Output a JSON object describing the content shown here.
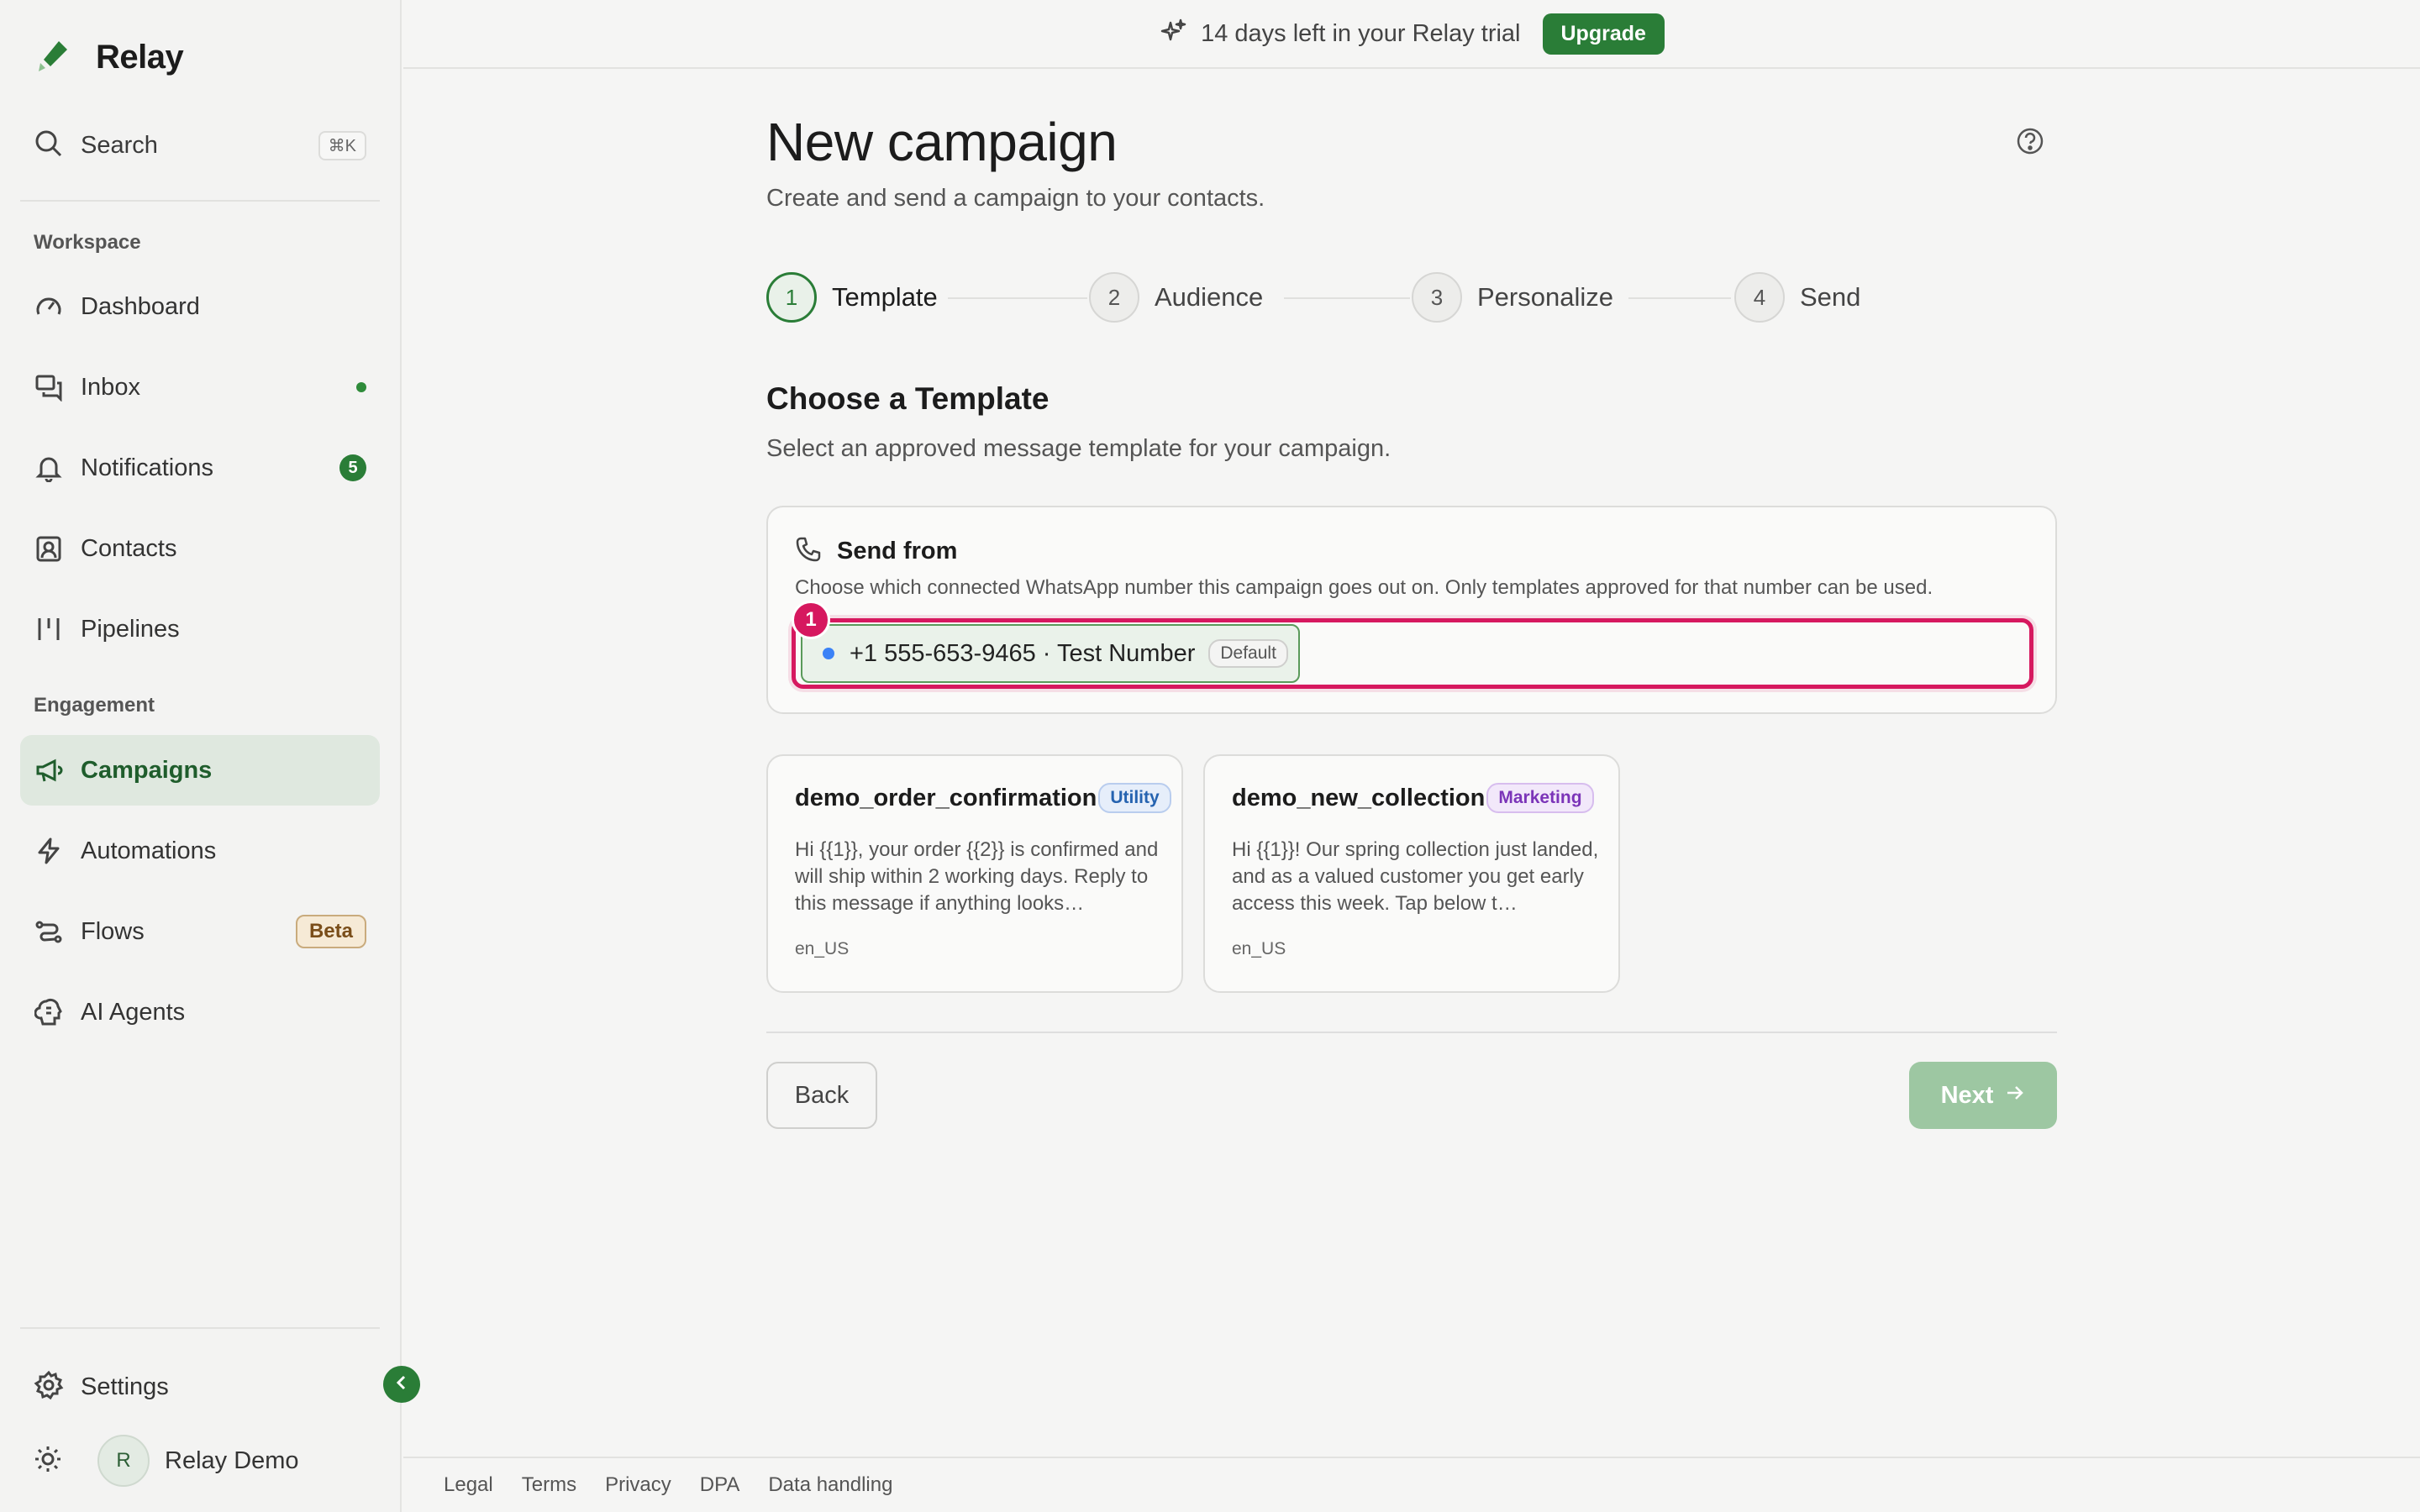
{
  "app": {
    "name": "Relay",
    "accent_color": "#2a7d37",
    "highlight_color": "#d6185f"
  },
  "sidebar": {
    "search": {
      "label": "Search",
      "shortcut": "⌘K"
    },
    "sections": {
      "workspace": "Workspace",
      "engagement": "Engagement"
    },
    "items": [
      {
        "label": "Dashboard",
        "icon": "gauge-icon"
      },
      {
        "label": "Inbox",
        "icon": "chat-icon",
        "indicator": "dot"
      },
      {
        "label": "Notifications",
        "icon": "bell-icon",
        "count": "5"
      },
      {
        "label": "Contacts",
        "icon": "contacts-icon"
      },
      {
        "label": "Pipelines",
        "icon": "pipeline-icon"
      },
      {
        "label": "Campaigns",
        "icon": "megaphone-icon",
        "active": true
      },
      {
        "label": "Automations",
        "icon": "lightning-icon"
      },
      {
        "label": "Flows",
        "icon": "flows-icon",
        "badge": "Beta"
      },
      {
        "label": "AI Agents",
        "icon": "brain-icon"
      }
    ],
    "settings": "Settings",
    "user": {
      "initial": "R",
      "name": "Relay Demo"
    }
  },
  "banner": {
    "message": "14 days left in your Relay trial",
    "upgrade_label": "Upgrade"
  },
  "page": {
    "title": "New campaign",
    "subtitle": "Create and send a campaign to your contacts."
  },
  "steps": [
    {
      "number": "1",
      "label": "Template",
      "current": true
    },
    {
      "number": "2",
      "label": "Audience"
    },
    {
      "number": "3",
      "label": "Personalize"
    },
    {
      "number": "4",
      "label": "Send"
    }
  ],
  "template_section": {
    "heading": "Choose a Template",
    "description": "Select an approved message template for your campaign."
  },
  "send_from": {
    "title": "Send from",
    "description": "Choose which connected WhatsApp number this campaign goes out on. Only templates approved for that number can be used.",
    "marker": "1",
    "number": "+1 555-653-9465 · Test Number",
    "default_badge": "Default"
  },
  "templates": [
    {
      "name": "demo_order_confirmation",
      "category": "Utility",
      "body": "Hi {{1}}, your order {{2}} is confirmed and will ship within 2 working days. Reply to this message if anything looks…",
      "language": "en_US"
    },
    {
      "name": "demo_new_collection",
      "category": "Marketing",
      "body": "Hi {{1}}! Our spring collection just landed, and as a valued customer you get early access this week. Tap below t…",
      "language": "en_US"
    }
  ],
  "actions": {
    "back": "Back",
    "next": "Next"
  },
  "footer": {
    "links": [
      "Legal",
      "Terms",
      "Privacy",
      "DPA",
      "Data handling"
    ]
  }
}
